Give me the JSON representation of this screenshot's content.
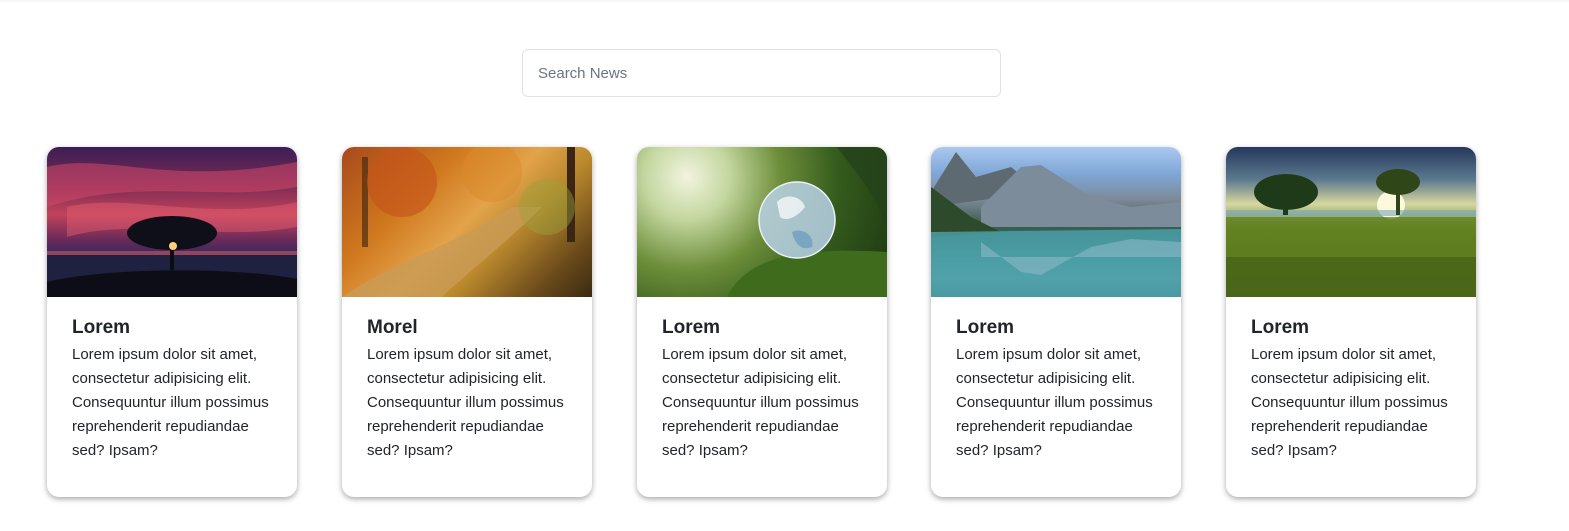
{
  "search": {
    "placeholder": "Search News",
    "value": ""
  },
  "cards": [
    {
      "title": "Lorem",
      "text": "Lorem ipsum dolor sit amet, consectetur adipisicing elit. Consequuntur illum possimus reprehenderit repudiandae sed? Ipsam?",
      "image": "sunset-tree-image"
    },
    {
      "title": "Morel",
      "text": "Lorem ipsum dolor sit amet, consectetur adipisicing elit. Consequuntur illum possimus reprehenderit repudiandae sed? Ipsam?",
      "image": "autumn-forest-image"
    },
    {
      "title": "Lorem",
      "text": "Lorem ipsum dolor sit amet, consectetur adipisicing elit. Consequuntur illum possimus reprehenderit repudiandae sed? Ipsam?",
      "image": "glass-globe-image"
    },
    {
      "title": "Lorem",
      "text": "Lorem ipsum dolor sit amet, consectetur adipisicing elit. Consequuntur illum possimus reprehenderit repudiandae sed? Ipsam?",
      "image": "mountain-lake-image"
    },
    {
      "title": "Lorem",
      "text": "Lorem ipsum dolor sit amet, consectetur adipisicing elit. Consequuntur illum possimus reprehenderit repudiandae sed? Ipsam?",
      "image": "meadow-tree-image"
    }
  ]
}
